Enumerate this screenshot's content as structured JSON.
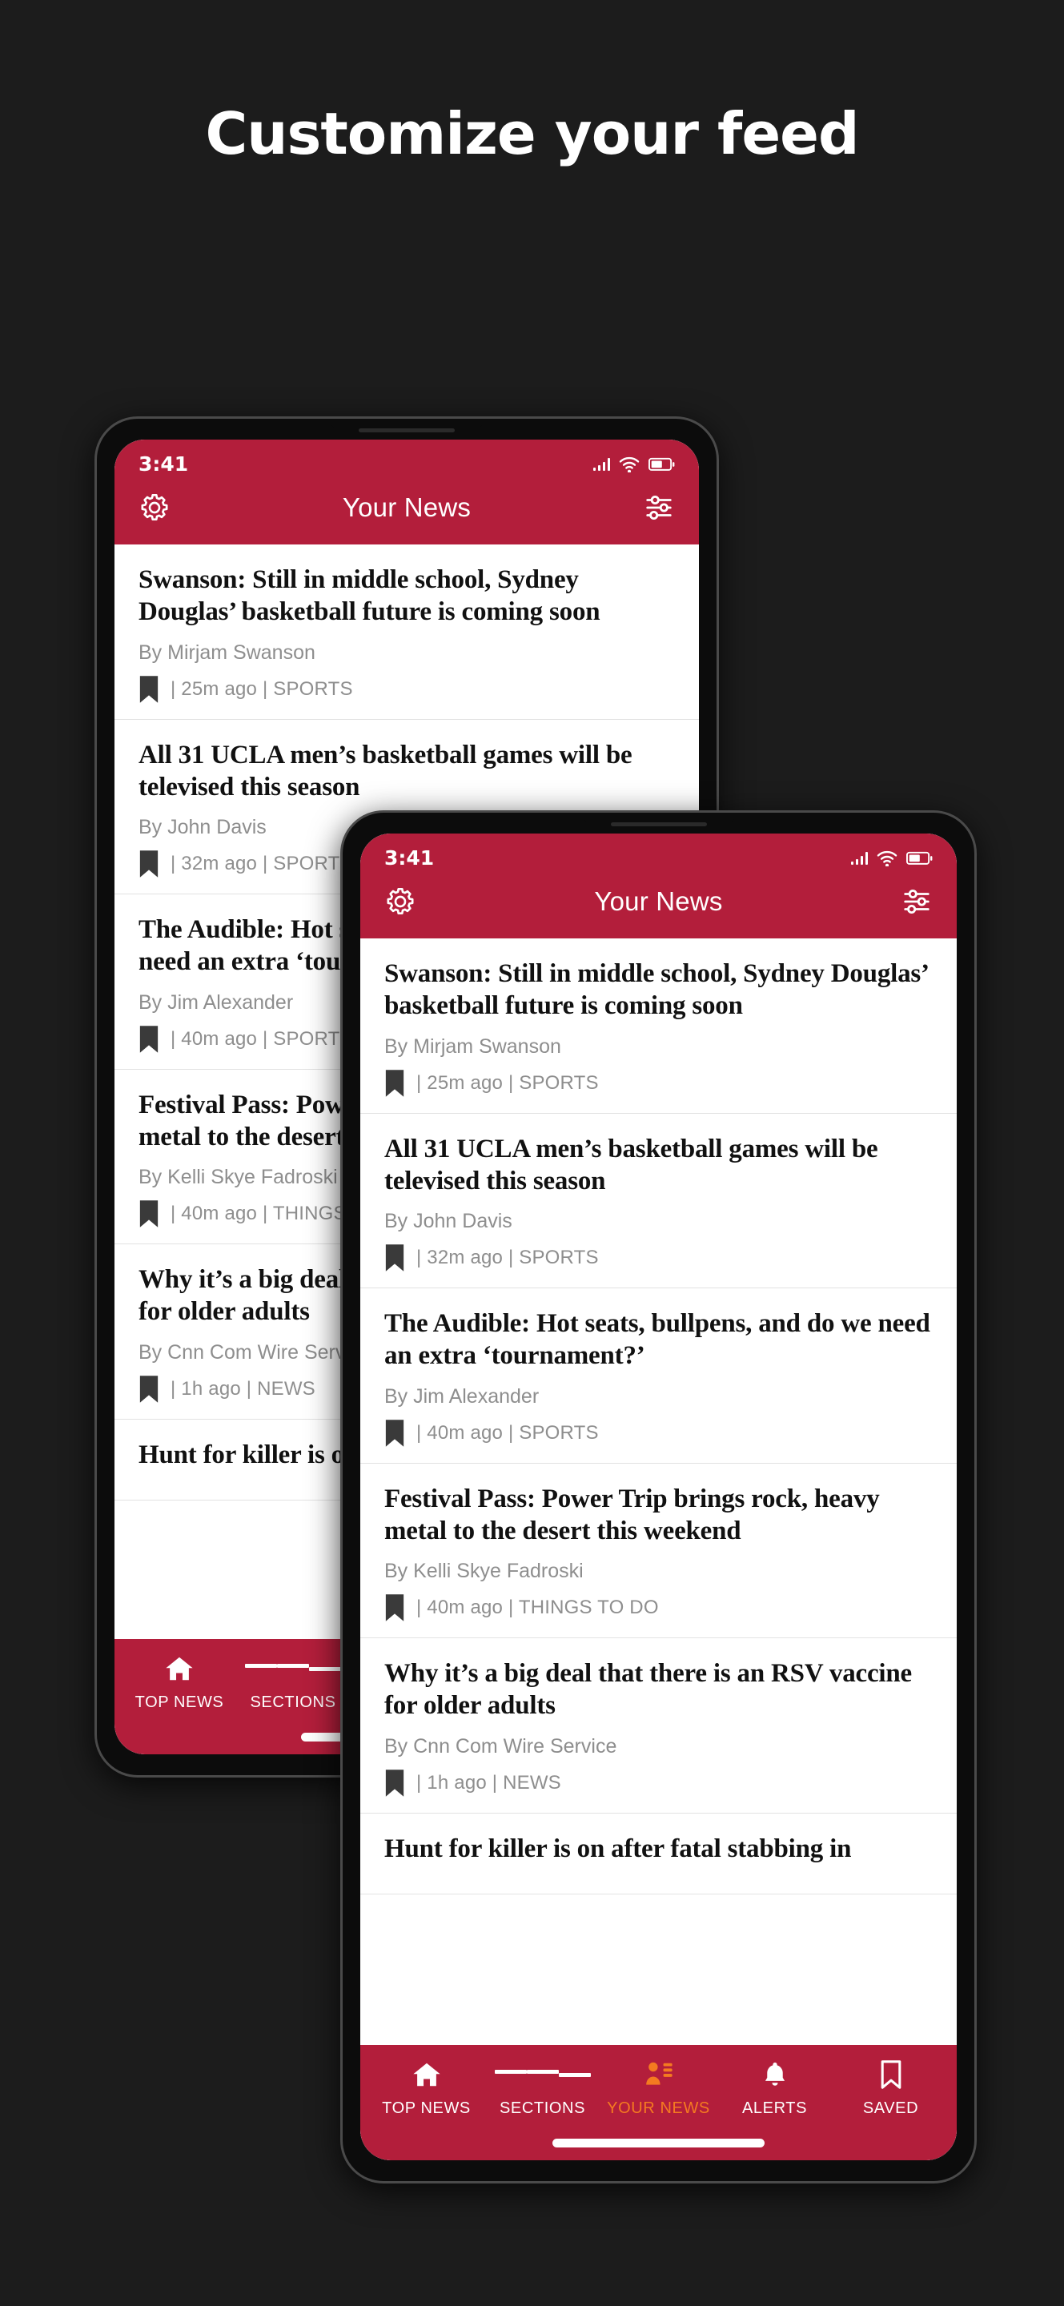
{
  "promo": {
    "title": "Customize your feed"
  },
  "brand": {
    "red": "#b31e3b",
    "accent_orange": "#f47a20"
  },
  "status_bar": {
    "time": "3:41",
    "signal_icon": "signal-bars-icon",
    "wifi_icon": "wifi-icon",
    "battery_icon": "battery-icon"
  },
  "app_bar": {
    "title": "Your News",
    "settings_icon": "gear-icon",
    "filter_icon": "sliders-icon"
  },
  "articles": [
    {
      "headline": "Swanson: Still in middle school, Sydney Douglas’ basketball future is coming soon",
      "byline": "By Mirjam Swanson",
      "bookmark_icon": "bookmark-icon",
      "meta": "| 25m ago | SPORTS"
    },
    {
      "headline": "All 31 UCLA men’s basketball games will be televised this season",
      "byline": "By John Davis",
      "bookmark_icon": "bookmark-icon",
      "meta": "| 32m ago | SPORTS"
    },
    {
      "headline": "The Audible: Hot seats, bullpens, and do we need an extra ‘tournament?’",
      "byline": "By Jim Alexander",
      "bookmark_icon": "bookmark-icon",
      "meta": "| 40m ago | SPORTS"
    },
    {
      "headline": "Festival Pass: Power Trip brings rock, heavy metal to the desert this weekend",
      "byline": "By Kelli Skye Fadroski",
      "bookmark_icon": "bookmark-icon",
      "meta": "| 40m ago | THINGS TO DO"
    },
    {
      "headline": "Why it’s a big deal that there is an RSV vaccine for older adults",
      "byline": "By Cnn Com Wire Service",
      "bookmark_icon": "bookmark-icon",
      "meta": "| 1h ago | NEWS"
    },
    {
      "headline": "Hunt for killer is on after fatal stabbing in",
      "byline": "",
      "bookmark_icon": "bookmark-icon",
      "meta": ""
    }
  ],
  "bottom_nav": {
    "items": [
      {
        "label": "TOP NEWS",
        "icon": "home-icon",
        "active": false
      },
      {
        "label": "SECTIONS",
        "icon": "hamburger-icon",
        "active": false
      },
      {
        "label": "YOUR NEWS",
        "icon": "person-list-icon",
        "active": true
      },
      {
        "label": "ALERTS",
        "icon": "bell-icon",
        "active": false
      },
      {
        "label": "SAVED",
        "icon": "bookmark-icon",
        "active": false
      }
    ]
  }
}
